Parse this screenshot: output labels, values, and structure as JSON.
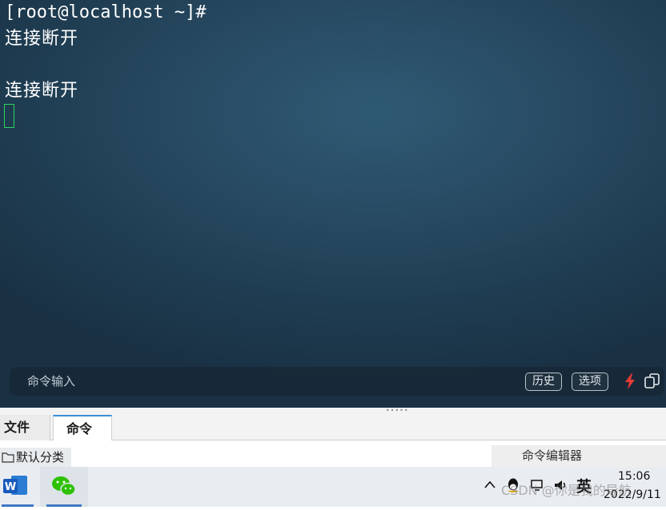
{
  "terminal": {
    "lines": [
      "[root@localhost ~]#",
      "连接断开",
      "",
      "连接断开"
    ]
  },
  "command_bar": {
    "placeholder": "命令输入",
    "history_label": "历史",
    "options_label": "选项",
    "accent_bolt": "#e53935"
  },
  "bottom_tabs": {
    "files_label": "文件",
    "command_label": "命令"
  },
  "panel": {
    "tree_item": "默认分类",
    "editor_label": "命令编辑器"
  },
  "taskbar": {
    "apps": [
      "word-icon",
      "wechat-icon"
    ],
    "ime_label": "英",
    "time": "15:06",
    "date": "2022/9/11",
    "watermark": "CSDN @你是我的导航"
  }
}
